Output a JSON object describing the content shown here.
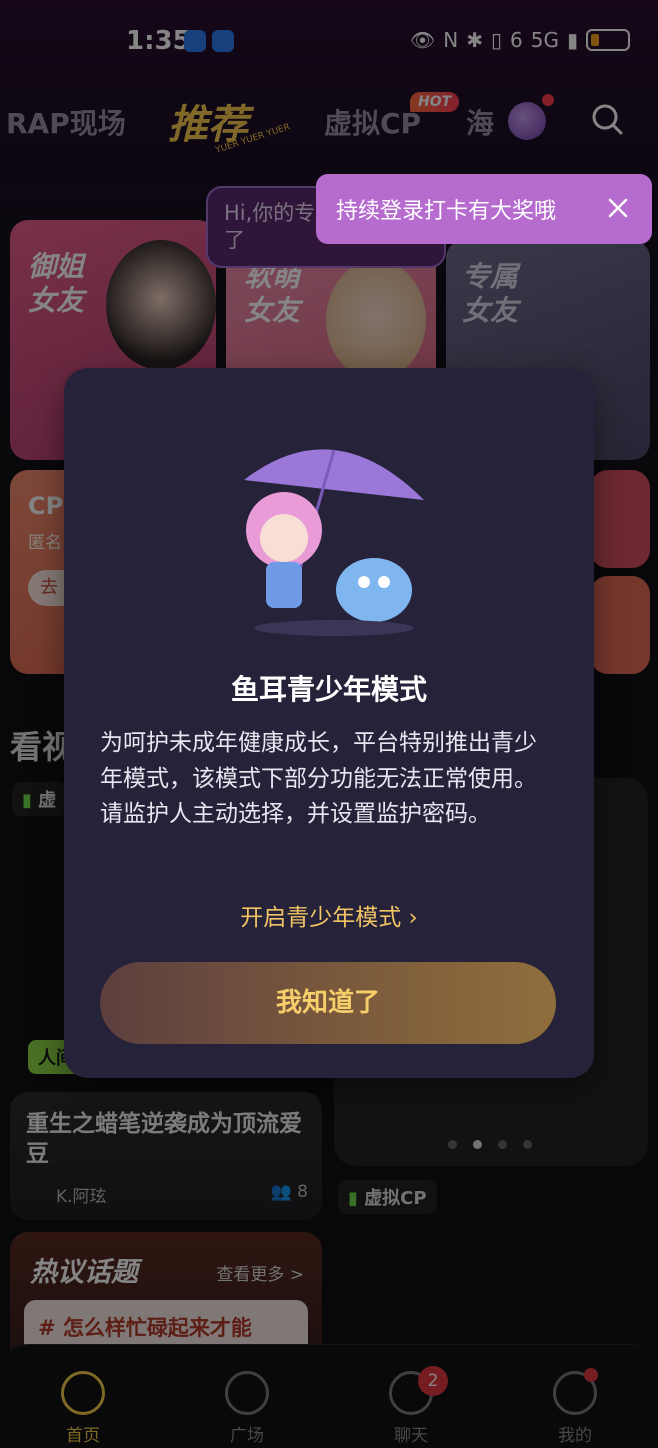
{
  "status_bar": {
    "time": "1:35",
    "network": "5G",
    "wifi_label": "6"
  },
  "top_nav": {
    "tabs": [
      "RAP现场",
      "推荐",
      "虚拟CP",
      "海"
    ],
    "active_tab": "推荐",
    "active_tab_sub": "YUER YUER YUER",
    "hot_badge": "HOT"
  },
  "tooltip": {
    "text": "持续登录打卡有大奖哦"
  },
  "feature_cards": [
    {
      "title": "御姐\n女友"
    },
    {
      "title": "软萌\n女友"
    },
    {
      "title": "专属\n女友"
    }
  ],
  "chat_bubble": {
    "text": "Hi,你的专属女友 上线了"
  },
  "cp_card": {
    "title": "CP",
    "subtitle": "匿名",
    "button": "去"
  },
  "section": {
    "title": "看视"
  },
  "chips": {
    "virtual_cp_top": "虚",
    "human_chip": "人间",
    "virtual_cp_bottom": "虚拟CP"
  },
  "post": {
    "title": "重生之蜡笔逆袭成为顶流爱豆",
    "author": "K.阿玹",
    "count": "8"
  },
  "hot_topics": {
    "title": "热议话题",
    "more": "查看更多 >",
    "item": "# 怎么样忙碌起来才能"
  },
  "carousel": {
    "count": 4,
    "active_index": 1
  },
  "bottom_nav": {
    "items": [
      "首页",
      "广场",
      "聊天",
      "我的"
    ],
    "active": "首页",
    "chat_badge": "2"
  },
  "modal": {
    "title": "鱼耳青少年模式",
    "body": "为呵护未成年健康成长，平台特别推出青少年模式，该模式下部分功能无法正常使用。请监护人主动选择，并设置监护密码。",
    "link": "开启青少年模式 ›",
    "button": "我知道了"
  },
  "colors": {
    "accent_gold": "#f2c94c",
    "modal_bg": "#25223a",
    "tooltip_bg": "#b66bcf",
    "badge_red": "#e0383e"
  }
}
